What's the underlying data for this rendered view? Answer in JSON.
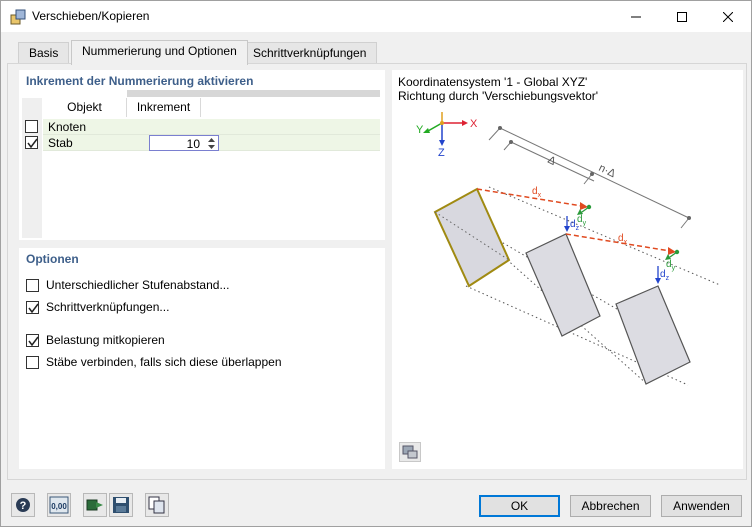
{
  "window": {
    "title": "Verschieben/Kopieren"
  },
  "tabs": [
    {
      "label": "Basis"
    },
    {
      "label": "Nummerierung und Optionen"
    },
    {
      "label": "Schrittverknüpfungen"
    }
  ],
  "numbering": {
    "title": "Inkrement der Nummerierung aktivieren",
    "columns": {
      "object": "Objekt",
      "increment": "Inkrement"
    },
    "rows": [
      {
        "label": "Knoten",
        "checked": false,
        "increment": ""
      },
      {
        "label": "Stab",
        "checked": true,
        "increment": "10"
      }
    ]
  },
  "options": {
    "title": "Optionen",
    "items": [
      {
        "label": "Unterschiedlicher Stufenabstand...",
        "checked": false
      },
      {
        "label": "Schrittverknüpfungen...",
        "checked": true
      },
      {
        "label": "Belastung mitkopieren",
        "checked": true
      },
      {
        "label": "Stäbe verbinden, falls sich diese überlappen",
        "checked": false
      }
    ]
  },
  "preview": {
    "line1": "Koordinatensystem '1 - Global XYZ'",
    "line2": "Richtung durch 'Verschiebungsvektor'",
    "axis_x": "X",
    "axis_y": "Y",
    "axis_z": "Z",
    "delta": "Δ",
    "n_delta": "n·Δ",
    "dx": "d",
    "dx_sub": "x",
    "dy": "d",
    "dy_sub": "y",
    "dz": "d",
    "dz_sub": "z"
  },
  "footer": {
    "icons": [
      "help-icon",
      "units-icon",
      "transfer-icon",
      "save-icon",
      "copy-icon"
    ],
    "units_label": "0,00",
    "ok_label": "OK",
    "cancel_label": "Abbrechen",
    "apply_label": "Anwenden"
  },
  "colors": {
    "accent": "#3e5f8a",
    "highlight_band": "#eef6e6",
    "focus": "#0078d7",
    "member_selected": "#a08a12",
    "arrow_dx": "#e04a20"
  }
}
